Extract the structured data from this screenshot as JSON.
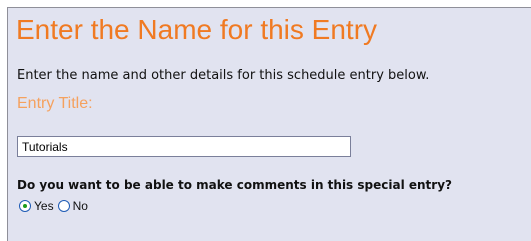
{
  "heading": "Enter the Name for this Entry",
  "intro_text": "Enter the name and other details for this schedule entry below.",
  "entry_title_label": "Entry Title:",
  "entry_title_value": "Tutorials",
  "comments_question": "Do you want to be able to make comments in this special entry?",
  "comments_options": [
    {
      "label": "Yes",
      "selected": true
    },
    {
      "label": "No",
      "selected": false
    }
  ],
  "colors": {
    "heading": "#f07a22",
    "label": "#f5a15e",
    "panel_background": "#e1e3f0"
  }
}
